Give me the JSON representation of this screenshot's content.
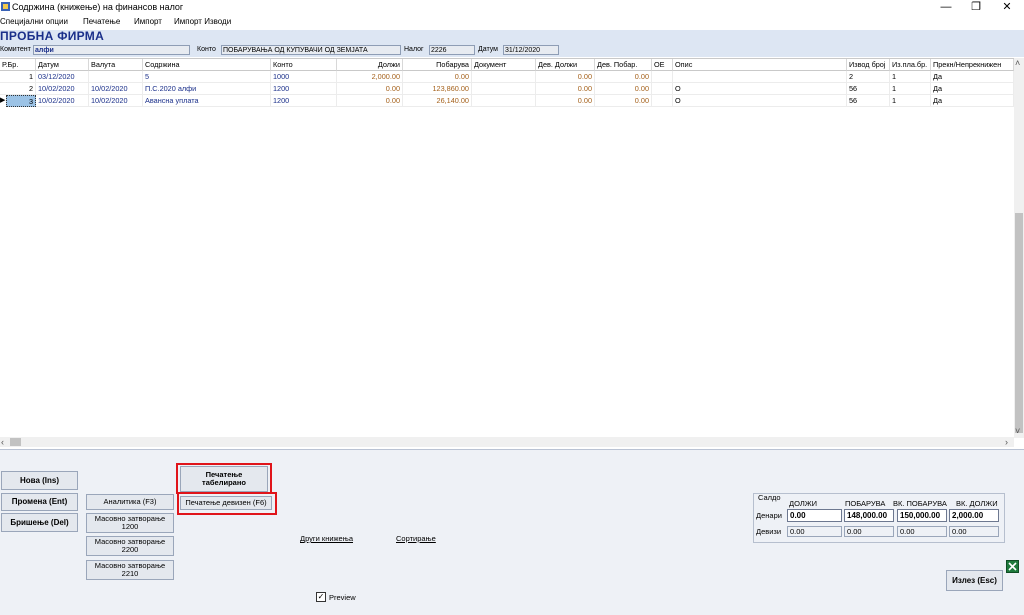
{
  "window": {
    "title": "Содржина (книжење) на финансов налог",
    "controls": {
      "minimize": "—",
      "restore": "❐",
      "close": "✕"
    }
  },
  "menu": [
    "Специјални опции",
    "Печатење",
    "Импорт",
    "Импорт Изводи"
  ],
  "company": "ПРОБНА ФИРМА",
  "filters": {
    "komitent_label": "Комитент",
    "komitent_value": "алфи",
    "konto_label": "Конто",
    "konto_value": "ПОБАРУВАЊА ОД КУПУВАЧИ ОД ЗЕМЈАТА",
    "nalog_label": "Налог",
    "nalog_value": "2226",
    "datum_label": "Датум",
    "datum_value": "31/12/2020"
  },
  "grid": {
    "headers": [
      "Р.Бр.",
      "Датум",
      "Валута",
      "Содржина",
      "Конто",
      "Должи",
      "Побарува",
      "Документ",
      "Дев. Должи",
      "Дев. Побар.",
      "ОЕ",
      "Опис",
      "Извод број",
      "Из.пла.бр.",
      "Прекн/Непрекнижен"
    ],
    "rows": [
      [
        "1",
        "03/12/2020",
        "",
        "5",
        "1000",
        "2,000.00",
        "0.00",
        "",
        "0.00",
        "0.00",
        "",
        "",
        "2",
        "1",
        "Да"
      ],
      [
        "2",
        "10/02/2020",
        "10/02/2020",
        "П.С.2020 алфи",
        "1200",
        "0.00",
        "123,860.00",
        "",
        "0.00",
        "0.00",
        "",
        "О",
        "56",
        "1",
        "Да"
      ],
      [
        "3",
        "10/02/2020",
        "10/02/2020",
        "Авансна уплата",
        "1200",
        "0.00",
        "26,140.00",
        "",
        "0.00",
        "0.00",
        "",
        "О",
        "56",
        "1",
        "Да"
      ]
    ]
  },
  "buttons": {
    "nova": "Нова (Ins)",
    "promena": "Промена (Ent)",
    "brishenje": "Бришење (Del)",
    "analitika": "Аналитика (F3)",
    "masovno_1200": "Масовно затворање 1200",
    "masovno_2200": "Масовно затворање 2200",
    "masovno_2210": "Масовно затворање 2210",
    "pechatenje_tabelirano": "Печатење табелирано",
    "pechatenje_devizen": "Печатење девизен (F6)",
    "drugi_knizhenja": "Други книжења",
    "sortiranje": "Сортирање",
    "preview": "Preview",
    "izlez": "Излез (Esc)"
  },
  "saldo": {
    "title": "Салдо",
    "col_headers": [
      "ДОЛЖИ",
      "ПОБАРУВА",
      "ВК. ПОБАРУВА",
      "ВК. ДОЛЖИ"
    ],
    "denari_label": "Денари",
    "denari": [
      "0.00",
      "148,000.00",
      "150,000.00",
      "2,000.00"
    ],
    "devizi_label": "Девизи",
    "devizi": [
      "0.00",
      "0.00",
      "0.00",
      "0.00"
    ]
  },
  "colors": {
    "company": "#1a2f8a",
    "highlight": "#e0141a",
    "amount": "#a5611b"
  }
}
